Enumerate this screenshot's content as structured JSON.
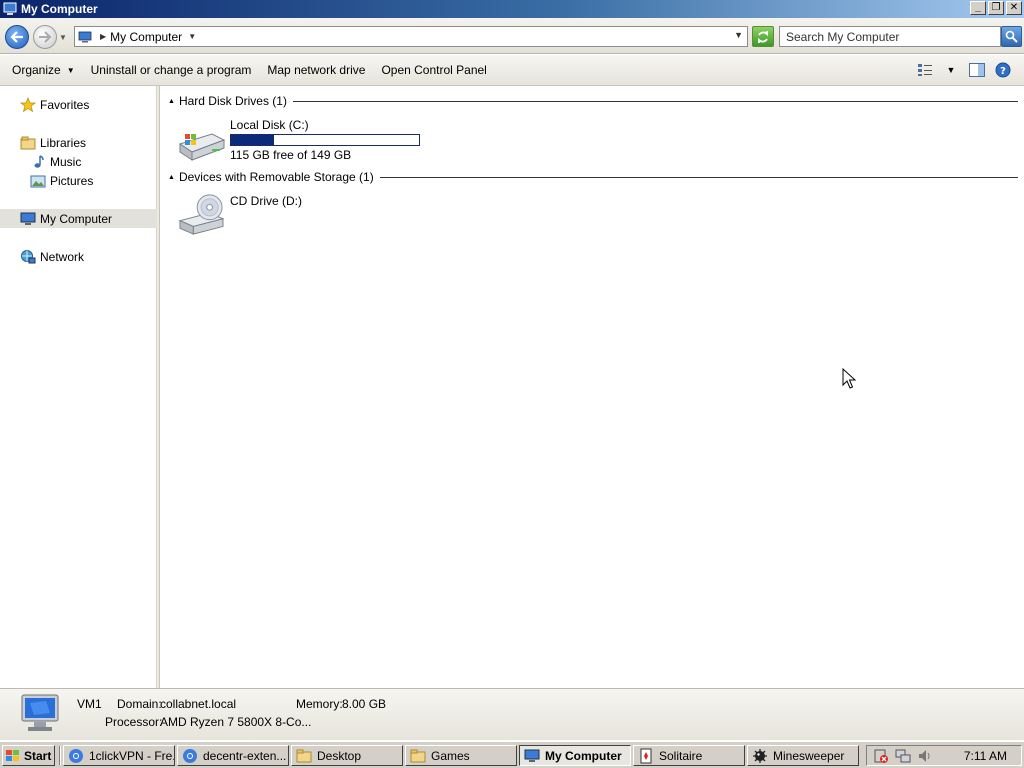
{
  "window": {
    "title": "My Computer"
  },
  "window_buttons": {
    "minimize": "_",
    "maximize": "❐",
    "close": "✕"
  },
  "address": {
    "location": "My Computer"
  },
  "search": {
    "placeholder": "Search My Computer"
  },
  "commands": {
    "organize": "Organize",
    "uninstall": "Uninstall or change a program",
    "map_drive": "Map network drive",
    "control_panel": "Open Control Panel"
  },
  "nav": {
    "favorites": "Favorites",
    "libraries": "Libraries",
    "music": "Music",
    "pictures": "Pictures",
    "computer": "My Computer",
    "network": "Network"
  },
  "groups": {
    "hdd_header": "Hard Disk Drives (1)",
    "removable_header": "Devices with Removable Storage (1)"
  },
  "drives": {
    "local": {
      "name": "Local Disk (C:)",
      "free_text": "115 GB free of 149 GB",
      "used_fraction": 0.23
    },
    "cd": {
      "name": "CD Drive (D:)"
    }
  },
  "details": {
    "name": "VM1",
    "domain_label": "Domain:",
    "domain_value": "collabnet.local",
    "memory_label": "Memory:",
    "memory_value": "8.00 GB",
    "processor_label": "Processor:",
    "processor_value": "AMD Ryzen 7 5800X 8-Co..."
  },
  "taskbar": {
    "start": "Start",
    "items": [
      {
        "label": "1clickVPN - Fre...",
        "icon": "chrome-icon"
      },
      {
        "label": "decentr-exten...",
        "icon": "chrome-icon"
      },
      {
        "label": "Desktop",
        "icon": "folder-icon"
      },
      {
        "label": "Games",
        "icon": "folder-icon"
      },
      {
        "label": "My Computer",
        "icon": "computer-icon",
        "active": true
      },
      {
        "label": "Solitaire",
        "icon": "solitaire-icon"
      },
      {
        "label": "Minesweeper",
        "icon": "minesweeper-icon"
      }
    ],
    "clock": "7:11 AM"
  },
  "colors": {
    "title_start": "#0a246a",
    "capacity_fill": "#0c2a7a",
    "selected_nav": "#e2e1dc"
  }
}
